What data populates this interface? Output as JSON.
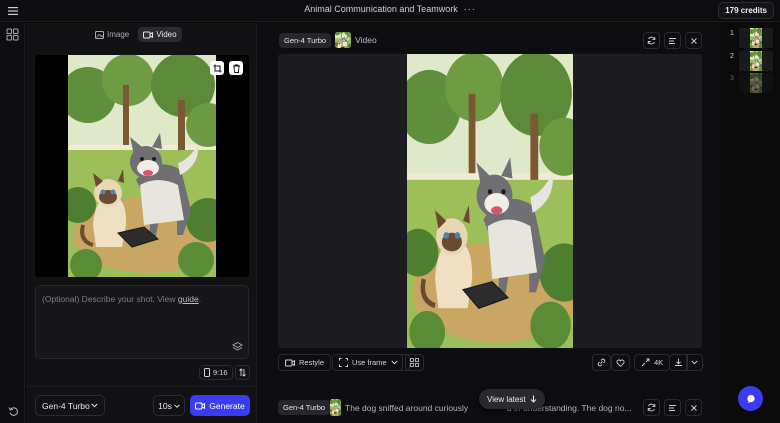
{
  "header": {
    "title": "Animal Communication and Teamwork",
    "more_glyph": "···",
    "credits": "179 credits"
  },
  "left_panel": {
    "tabs": [
      {
        "label": "Image",
        "icon": "image-icon"
      },
      {
        "label": "Video",
        "icon": "video-icon"
      }
    ],
    "active_tab": "Video",
    "prompt": {
      "placeholder": "(Optional) Describe your shot. View ",
      "link": "guide",
      "suffix": "."
    },
    "aspect_ratio": "9:16",
    "model": "Gen-4 Turbo",
    "duration": "10s",
    "generate_label": "Generate"
  },
  "main": {
    "card1": {
      "model": "Gen-4 Turbo",
      "kind": "Video",
      "actions": {
        "restyle": "Restyle",
        "use_frame": "Use frame",
        "resolution": "4K"
      }
    },
    "card2": {
      "model": "Gen-4 Turbo",
      "text": "The dog sniffed around curiously",
      "text_tail": "d in understanding. The dog no..."
    },
    "view_latest": "View latest"
  },
  "strip": {
    "items": [
      "1",
      "2",
      "3"
    ]
  },
  "colors": {
    "accent": "#3b3cf2",
    "background": "#0b0b0c",
    "panel": "#121214"
  }
}
